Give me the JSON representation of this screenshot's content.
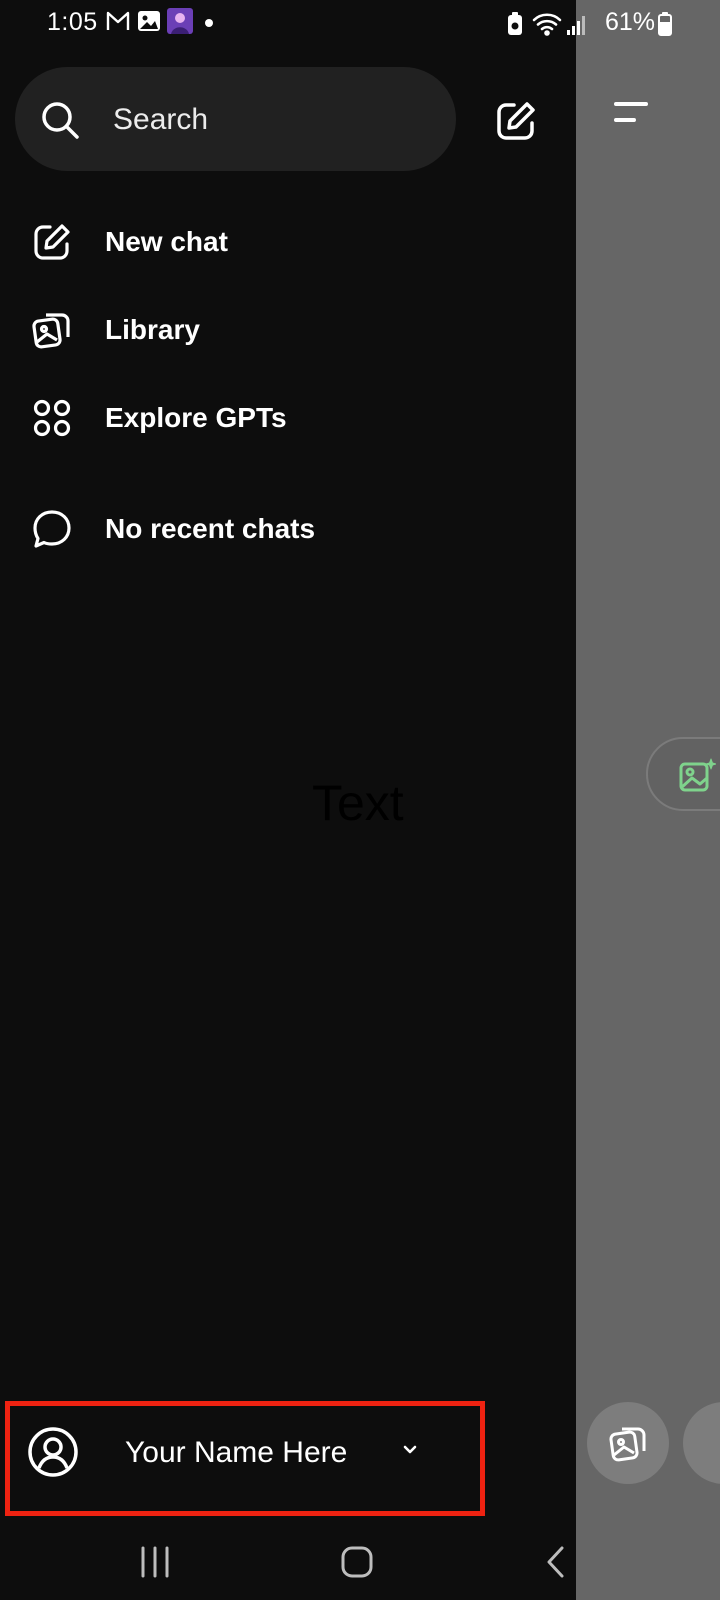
{
  "status_bar": {
    "time": "1:05",
    "battery_percent": "61%",
    "notification_icons": [
      "gmail-icon",
      "gallery-icon",
      "app-avatar-icon",
      "dot-icon"
    ],
    "system_icons": [
      "battery-saver-icon",
      "wifi-icon",
      "signal-icon",
      "battery-icon"
    ]
  },
  "drawer": {
    "search": {
      "placeholder": "Search"
    },
    "items": [
      {
        "label": "New chat",
        "icon": "edit-icon"
      },
      {
        "label": "Library",
        "icon": "library-icon"
      },
      {
        "label": "Explore GPTs",
        "icon": "grid-icon"
      },
      {
        "label": "No recent chats",
        "icon": "chat-bubble-icon"
      }
    ],
    "overlay_text": "Text",
    "account": {
      "name": "Your Name Here"
    }
  },
  "colors": {
    "drawer_bg": "#0d0d0d",
    "search_bg": "#212121",
    "dimmed_bg": "#666666",
    "highlight_border": "#ee2211",
    "suggestion_icon": "#7fd38c"
  },
  "nav_bar": {
    "buttons": [
      "recents-icon",
      "home-icon",
      "back-icon"
    ]
  }
}
